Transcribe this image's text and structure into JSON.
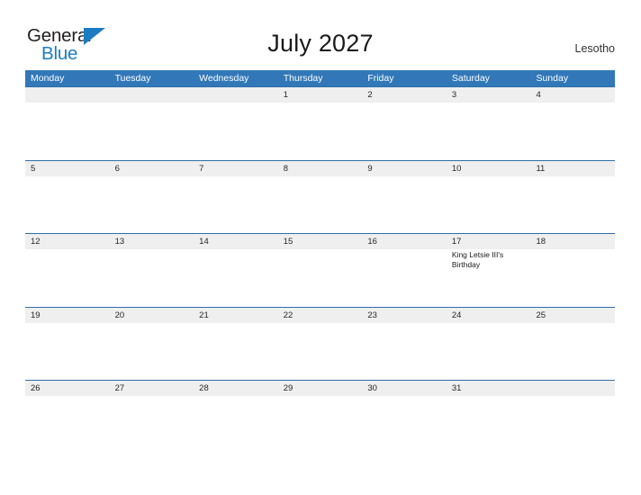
{
  "brand": {
    "name_part1": "General",
    "name_part2": "Blue",
    "triangle_color": "#1b7cc2",
    "text_color": "#231f20"
  },
  "header": {
    "title": "July 2027",
    "country": "Lesotho"
  },
  "theme": {
    "header_blue": "#3278b8",
    "date_band_gray": "#efefef",
    "row_line_blue": "#2f6fa8",
    "page_background": "#ffffff"
  },
  "calendar": {
    "month": "July",
    "year": "2027",
    "weekday_headers": [
      "Monday",
      "Tuesday",
      "Wednesday",
      "Thursday",
      "Friday",
      "Saturday",
      "Sunday"
    ],
    "weeks": [
      {
        "days": [
          {
            "num": "",
            "events": []
          },
          {
            "num": "",
            "events": []
          },
          {
            "num": "",
            "events": []
          },
          {
            "num": "1",
            "events": []
          },
          {
            "num": "2",
            "events": []
          },
          {
            "num": "3",
            "events": []
          },
          {
            "num": "4",
            "events": []
          }
        ]
      },
      {
        "days": [
          {
            "num": "5",
            "events": []
          },
          {
            "num": "6",
            "events": []
          },
          {
            "num": "7",
            "events": []
          },
          {
            "num": "8",
            "events": []
          },
          {
            "num": "9",
            "events": []
          },
          {
            "num": "10",
            "events": []
          },
          {
            "num": "11",
            "events": []
          }
        ]
      },
      {
        "days": [
          {
            "num": "12",
            "events": []
          },
          {
            "num": "13",
            "events": []
          },
          {
            "num": "14",
            "events": []
          },
          {
            "num": "15",
            "events": []
          },
          {
            "num": "16",
            "events": []
          },
          {
            "num": "17",
            "events": [
              "King Letsie III's Birthday"
            ]
          },
          {
            "num": "18",
            "events": []
          }
        ]
      },
      {
        "days": [
          {
            "num": "19",
            "events": []
          },
          {
            "num": "20",
            "events": []
          },
          {
            "num": "21",
            "events": []
          },
          {
            "num": "22",
            "events": []
          },
          {
            "num": "23",
            "events": []
          },
          {
            "num": "24",
            "events": []
          },
          {
            "num": "25",
            "events": []
          }
        ]
      },
      {
        "days": [
          {
            "num": "26",
            "events": []
          },
          {
            "num": "27",
            "events": []
          },
          {
            "num": "28",
            "events": []
          },
          {
            "num": "29",
            "events": []
          },
          {
            "num": "30",
            "events": []
          },
          {
            "num": "31",
            "events": []
          },
          {
            "num": "",
            "events": []
          }
        ]
      }
    ]
  }
}
